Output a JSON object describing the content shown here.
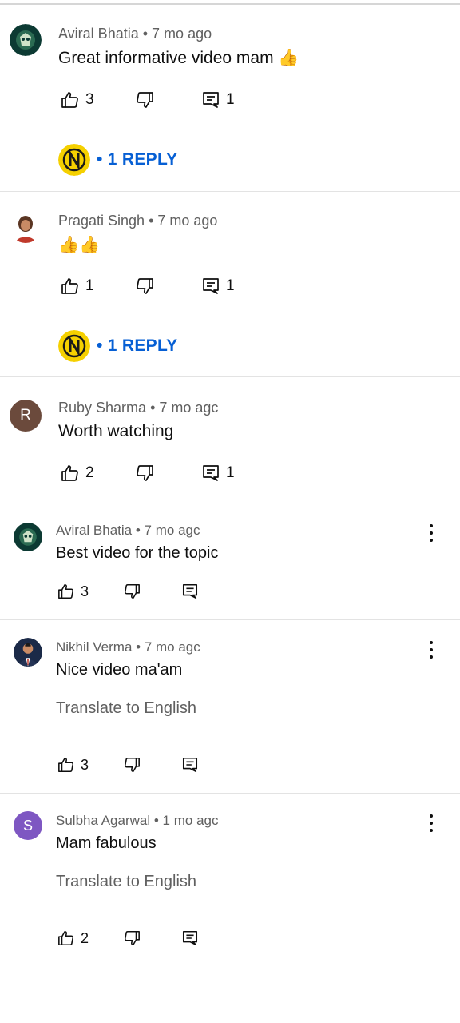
{
  "colors": {
    "link_blue": "#065fd4",
    "meta_gray": "#606060",
    "avatar_ruby": "#6b4a3c",
    "avatar_sulbha": "#7e57c2",
    "badge_yellow": "#f5d000"
  },
  "icons": [
    "thumbs-up-icon",
    "thumbs-down-icon",
    "reply-icon",
    "more-vert-icon",
    "emoji-thumbs-up"
  ],
  "comments": [
    {
      "author": "Aviral Bhatia",
      "age": "7 mo ago",
      "text": "Great informative video mam 👍",
      "likes": "3",
      "replies": "1",
      "reply_label": "• 1 REPLY"
    },
    {
      "author": "Pragati Singh",
      "age": "7 mo ago",
      "text": "👍👍",
      "likes": "1",
      "replies": "1",
      "reply_label": "• 1 REPLY"
    },
    {
      "author": "Ruby Sharma",
      "age": "7 mo agc",
      "avatar_letter": "R",
      "text": "Worth watching",
      "likes": "2",
      "replies": "1"
    },
    {
      "author": "Aviral Bhatia",
      "age": "7 mo agc",
      "text": "Best video for the topic",
      "likes": "3"
    },
    {
      "author": "Nikhil Verma",
      "age": "7 mo agc",
      "text": "Nice video ma'am",
      "translate": "Translate to English",
      "likes": "3"
    },
    {
      "author": "Sulbha Agarwal",
      "age": "1 mo agc",
      "avatar_letter": "S",
      "text": "Mam fabulous",
      "translate": "Translate to English",
      "likes": "2"
    }
  ]
}
